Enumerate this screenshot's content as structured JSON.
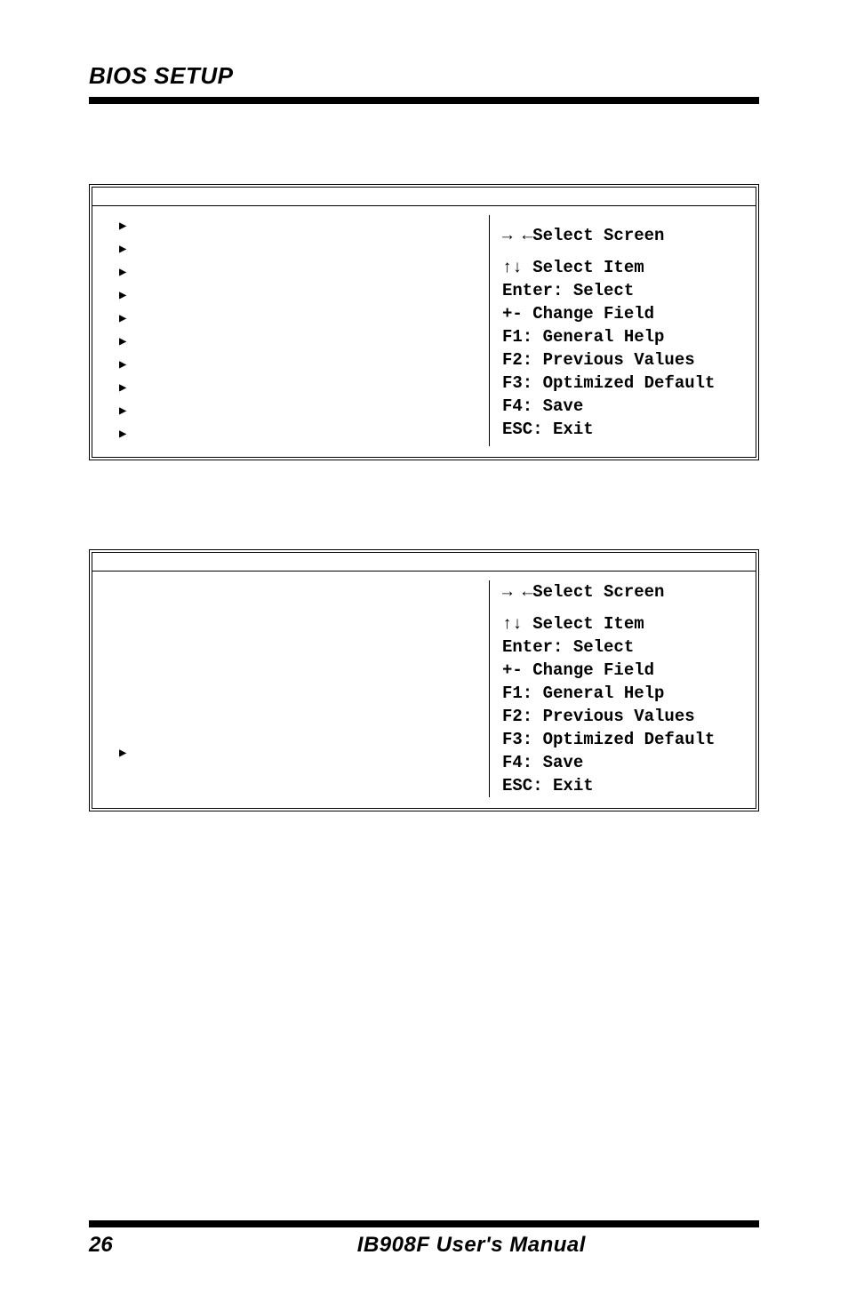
{
  "header": {
    "title": "BIOS SETUP"
  },
  "footer": {
    "page": "26",
    "manual": "IB908F User's Manual"
  },
  "help": {
    "select_screen": "→ ←Select Screen",
    "select_item": "↑↓ Select Item",
    "enter": "Enter: Select",
    "change": "+-  Change Field",
    "f1": "F1: General Help",
    "f2": "F2: Previous Values",
    "f3": "F3: Optimized Default",
    "f4": "F4: Save",
    "esc": "ESC: Exit"
  },
  "box1": {
    "rows": [
      "",
      "",
      "",
      "",
      "",
      "",
      "",
      "",
      "",
      ""
    ]
  },
  "box2": {
    "rows": [
      ""
    ]
  }
}
